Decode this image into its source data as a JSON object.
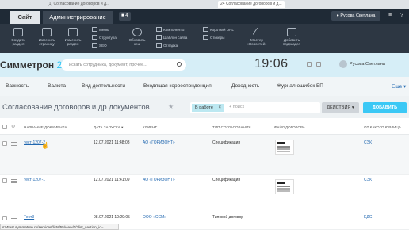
{
  "browser": {
    "tab1": "(1) Согласование договоров и д...",
    "tab2": "24 Согласование договоров и д..."
  },
  "admin_bar": {
    "site_tab": "Сайт",
    "admin_tab": "Администрирование",
    "notifications_count": "4",
    "user_button": "Русова Светлана"
  },
  "toolbar": {
    "buttons": [
      "Создать раздел",
      "Изменить страницу",
      "Изменить раздел",
      "Обновить кеш",
      "Мастер «Новостей»",
      "Добавить подраздел"
    ],
    "menus": [
      "Меню",
      "Структура",
      "SEO",
      "Компоненты",
      "Шаблон сайта",
      "Отладка",
      "Короткий URL",
      "Стикеры"
    ]
  },
  "portal": {
    "logo_main": "Симметрон",
    "logo_num": "24",
    "search_placeholder": "искать сотрудника, документ, прочее...",
    "clock": "19:06",
    "user_name": "Русова Светлана"
  },
  "nav": {
    "items": [
      "Важность",
      "Валюта",
      "Вид деятельности",
      "Входящая корреспонденция",
      "Доходность",
      "Журнал ошибок БП"
    ],
    "more": "Еще"
  },
  "page": {
    "title": "Согласование договоров и др.документов",
    "filter_tag": "В работе",
    "filter_placeholder": "+ поиск",
    "actions_button": "ДЕЙСТВИЯ",
    "add_button": "ДОБАВИТЬ"
  },
  "table": {
    "columns": [
      "НАЗВАНИЕ ДОКУМЕНТА",
      "ДАТА ЗАПУСКА",
      "КЛИЕНТ",
      "ТИП СОГЛАСОВАНИЯ",
      "ФАЙЛ ДОГОВОРА",
      "ОТ КАКОГО ЮРЛИЦА"
    ],
    "rows": [
      {
        "name": "тест-1207-2",
        "date": "12.07.2021 11:48:03",
        "client": "АО «ГОРИЗОНТ»",
        "type": "Спецификация",
        "entity": "СЭК"
      },
      {
        "name": "тест-1207-1",
        "date": "12.07.2021 11:41:09",
        "client": "АО «ГОРИЗОНТ»",
        "type": "Спецификация",
        "entity": "СЭК"
      },
      {
        "name": "Тест3",
        "date": "08.07.2021 10:29:05",
        "client": "ООО «ССМ»",
        "type": "Типовой договор",
        "entity": "ЕДС"
      }
    ]
  },
  "status_bar": {
    "url": "s24test.symmetron.ru/services/lists/55/view/0/?list_section_id="
  }
}
